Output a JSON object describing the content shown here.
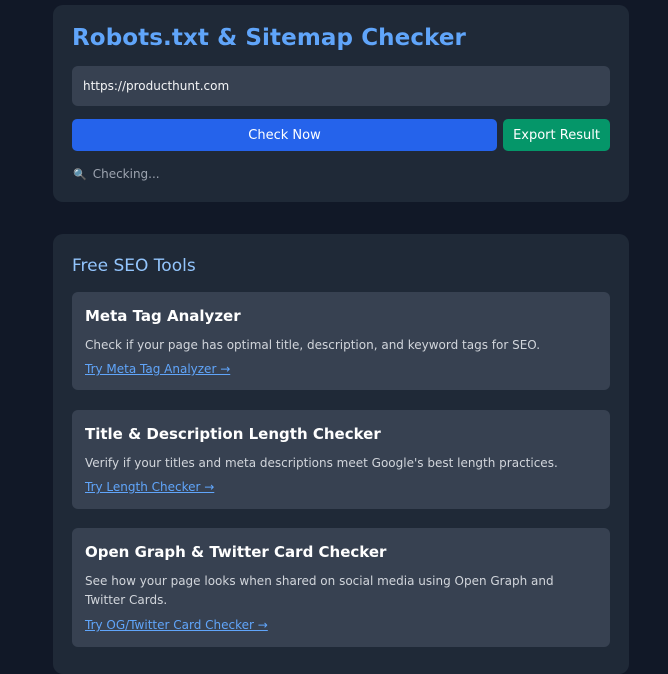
{
  "checker": {
    "title": "Robots.txt & Sitemap Checker",
    "url_value": "https://producthunt.com",
    "check_button": "Check Now",
    "export_button": "Export Result",
    "status_icon": "🔍",
    "status_text": "Checking..."
  },
  "tools": {
    "heading": "Free SEO Tools",
    "cards": [
      {
        "title": "Meta Tag Analyzer",
        "description": "Check if your page has optimal title, description, and keyword tags for SEO.",
        "link": "Try Meta Tag Analyzer →"
      },
      {
        "title": "Title & Description Length Checker",
        "description": "Verify if your titles and meta descriptions meet Google's best length practices.",
        "link": "Try Length Checker →"
      },
      {
        "title": "Open Graph & Twitter Card Checker",
        "description": "See how your page looks when shared on social media using Open Graph and Twitter Cards.",
        "link": "Try OG/Twitter Card Checker →"
      }
    ]
  },
  "colors": {
    "background": "#111827",
    "panel": "#1f2937",
    "card": "#374151",
    "accent": "#60a5fa",
    "primary_button": "#2563eb",
    "export_button": "#059669"
  }
}
